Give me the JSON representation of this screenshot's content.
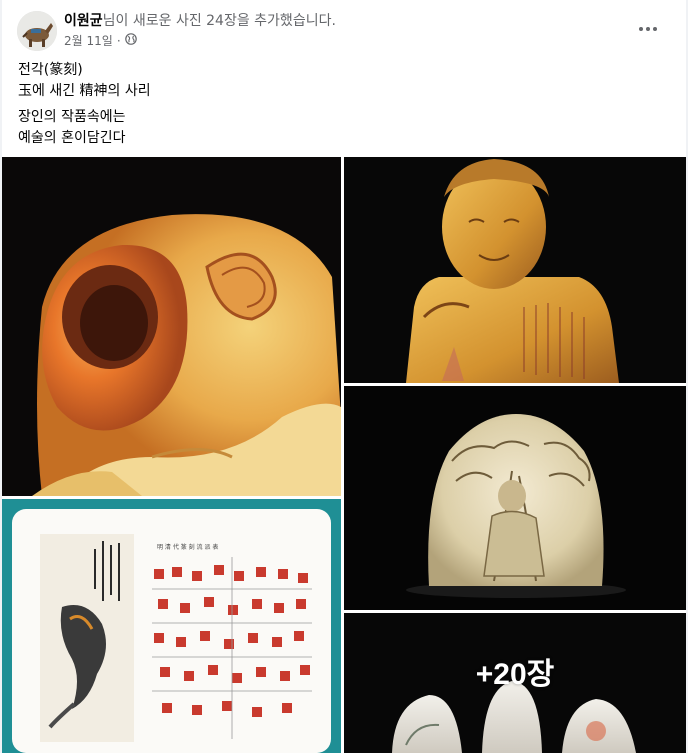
{
  "post": {
    "author": "이원균",
    "action": "님이 새로운 사진 24장을 추가했습니다.",
    "date": "2월 11일",
    "separator": "·",
    "privacy_icon": "globe-icon",
    "more_icon": "more-horizontal-icon",
    "text": {
      "line1": "전각(篆刻)",
      "line2": "玉에 새긴 精神의 사리",
      "line3": "장인의 작품속에는",
      "line4": "예술의 혼이담긴다"
    }
  },
  "photos": {
    "more_count": "+20장",
    "items": [
      {
        "subject": "orange-yellow carved stone closeup",
        "icon": "photo-icon"
      },
      {
        "subject": "carved figure seal",
        "icon": "photo-icon"
      },
      {
        "subject": "carved plaque with tree and figure",
        "icon": "photo-icon"
      },
      {
        "subject": "koi painting and seal chart page",
        "icon": "photo-icon"
      },
      {
        "subject": "three carved stones",
        "icon": "photo-icon"
      }
    ]
  },
  "colors": {
    "text_primary": "#050505",
    "text_secondary": "#65676b",
    "page_background": "#f0f2f5",
    "card_background": "#ffffff",
    "photo_background": "#000000",
    "teal_border": "#1f8f95"
  }
}
